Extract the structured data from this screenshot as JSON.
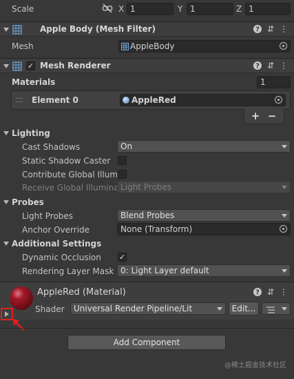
{
  "transform": {
    "scale_label": "Scale",
    "x_label": "X",
    "x_value": "1",
    "y_label": "Y",
    "y_value": "1",
    "z_label": "Z",
    "z_value": "1"
  },
  "mesh_filter": {
    "title": "Apple Body (Mesh Filter)",
    "mesh_label": "Mesh",
    "mesh_value": "AppleBody"
  },
  "mesh_renderer": {
    "title": "Mesh Renderer",
    "materials_label": "Materials",
    "materials_count": "1",
    "element_label": "Element 0",
    "element_value": "AppleRed",
    "add_label": "+",
    "remove_label": "−",
    "lighting_label": "Lighting",
    "cast_shadows_label": "Cast Shadows",
    "cast_shadows_value": "On",
    "static_shadow_label": "Static Shadow Caster",
    "contribute_gi_label": "Contribute Global Illumin",
    "receive_gi_label": "Receive Global Illuminati",
    "receive_gi_value": "Light Probes",
    "probes_label": "Probes",
    "light_probes_label": "Light Probes",
    "light_probes_value": "Blend Probes",
    "anchor_override_label": "Anchor Override",
    "anchor_override_value": "None (Transform)",
    "additional_label": "Additional Settings",
    "dynamic_occlusion_label": "Dynamic Occlusion",
    "rendering_layer_label": "Rendering Layer Mask",
    "rendering_layer_value": "0: Light Layer default"
  },
  "material": {
    "title": "AppleRed (Material)",
    "shader_label": "Shader",
    "shader_value": "Universal Render Pipeline/Lit",
    "edit_label": "Edit..."
  },
  "add_component_label": "Add Component",
  "watermark": "@稀土掘金技术社区",
  "icons": [
    "link-icon",
    "mesh-icon",
    "help-icon",
    "preset-icon",
    "menu-icon",
    "object-picker-icon",
    "checkmark-icon",
    "foldout-arrow-icon",
    "drag-handle-icon",
    "material-preview",
    "list-icon",
    "red-pointer-arrow"
  ],
  "colors": {
    "background": "#383838",
    "header": "#3e3e3e",
    "field": "#2a2a2a",
    "material_red": "#8b1522",
    "highlight": "#e02020"
  }
}
